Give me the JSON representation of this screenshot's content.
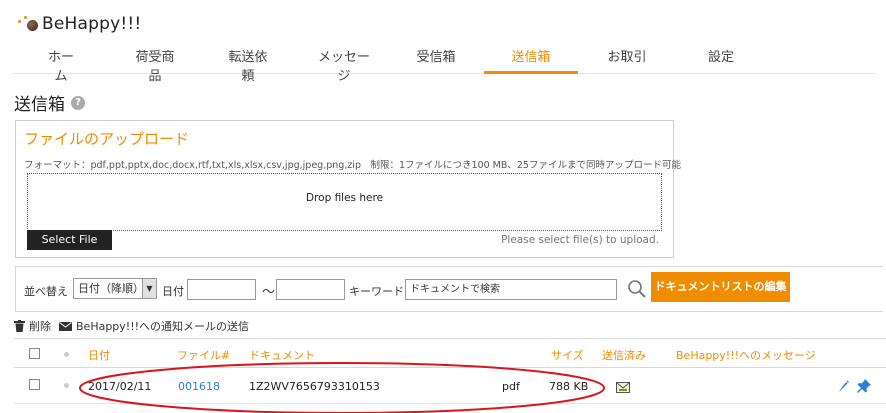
{
  "brand": {
    "name": "BeHappy!!!"
  },
  "nav": {
    "items": [
      {
        "label": "ホーム",
        "active": false
      },
      {
        "label": "荷受商品",
        "active": false
      },
      {
        "label": "転送依頼",
        "active": false
      },
      {
        "label": "メッセージ",
        "active": false
      },
      {
        "label": "受信箱",
        "active": false
      },
      {
        "label": "送信箱",
        "active": true
      },
      {
        "label": "お取引",
        "active": false
      },
      {
        "label": "設定",
        "active": false
      }
    ]
  },
  "page": {
    "title": "送信箱",
    "help_icon": "question-icon"
  },
  "upload": {
    "title": "ファイルのアップロード",
    "format_text": "フォーマット：pdf,ppt,pptx,doc,docx,rtf,txt,xls,xlsx,csv,jpg,jpeg,png,zip　制限：1ファイルにつき100 MB、25ファイルまで同時アップロード可能",
    "dropzone_text": "Drop files here",
    "select_button": "Select File",
    "hint": "Please select file(s) to upload."
  },
  "filter": {
    "sort_label": "並べ替え",
    "sort_value": "日付（降順）",
    "date_label": "日付",
    "range_sep": "～",
    "date_from": "",
    "date_to": "",
    "keyword_label": "キーワード",
    "keyword_placeholder": "ドキュメントで検索",
    "edit_button": "ドキュメントリストの編集"
  },
  "actions": {
    "delete_label": "削除",
    "notify_label": "BeHappy!!!への通知メールの送信"
  },
  "table": {
    "headers": {
      "date": "日付",
      "file_no": "ファイル#",
      "document": "ドキュメント",
      "size": "サイズ",
      "sent": "送信済み",
      "message": "BeHappy!!!へのメッセージ"
    },
    "rows": [
      {
        "date": "2017/02/11",
        "file_no": "001618",
        "document": "1Z2WV7656793310153",
        "type": "pdf",
        "size": "788 KB"
      }
    ]
  },
  "colors": {
    "accent": "#f08c00",
    "link": "#2f7fd0",
    "highlight": "#d8161b"
  }
}
